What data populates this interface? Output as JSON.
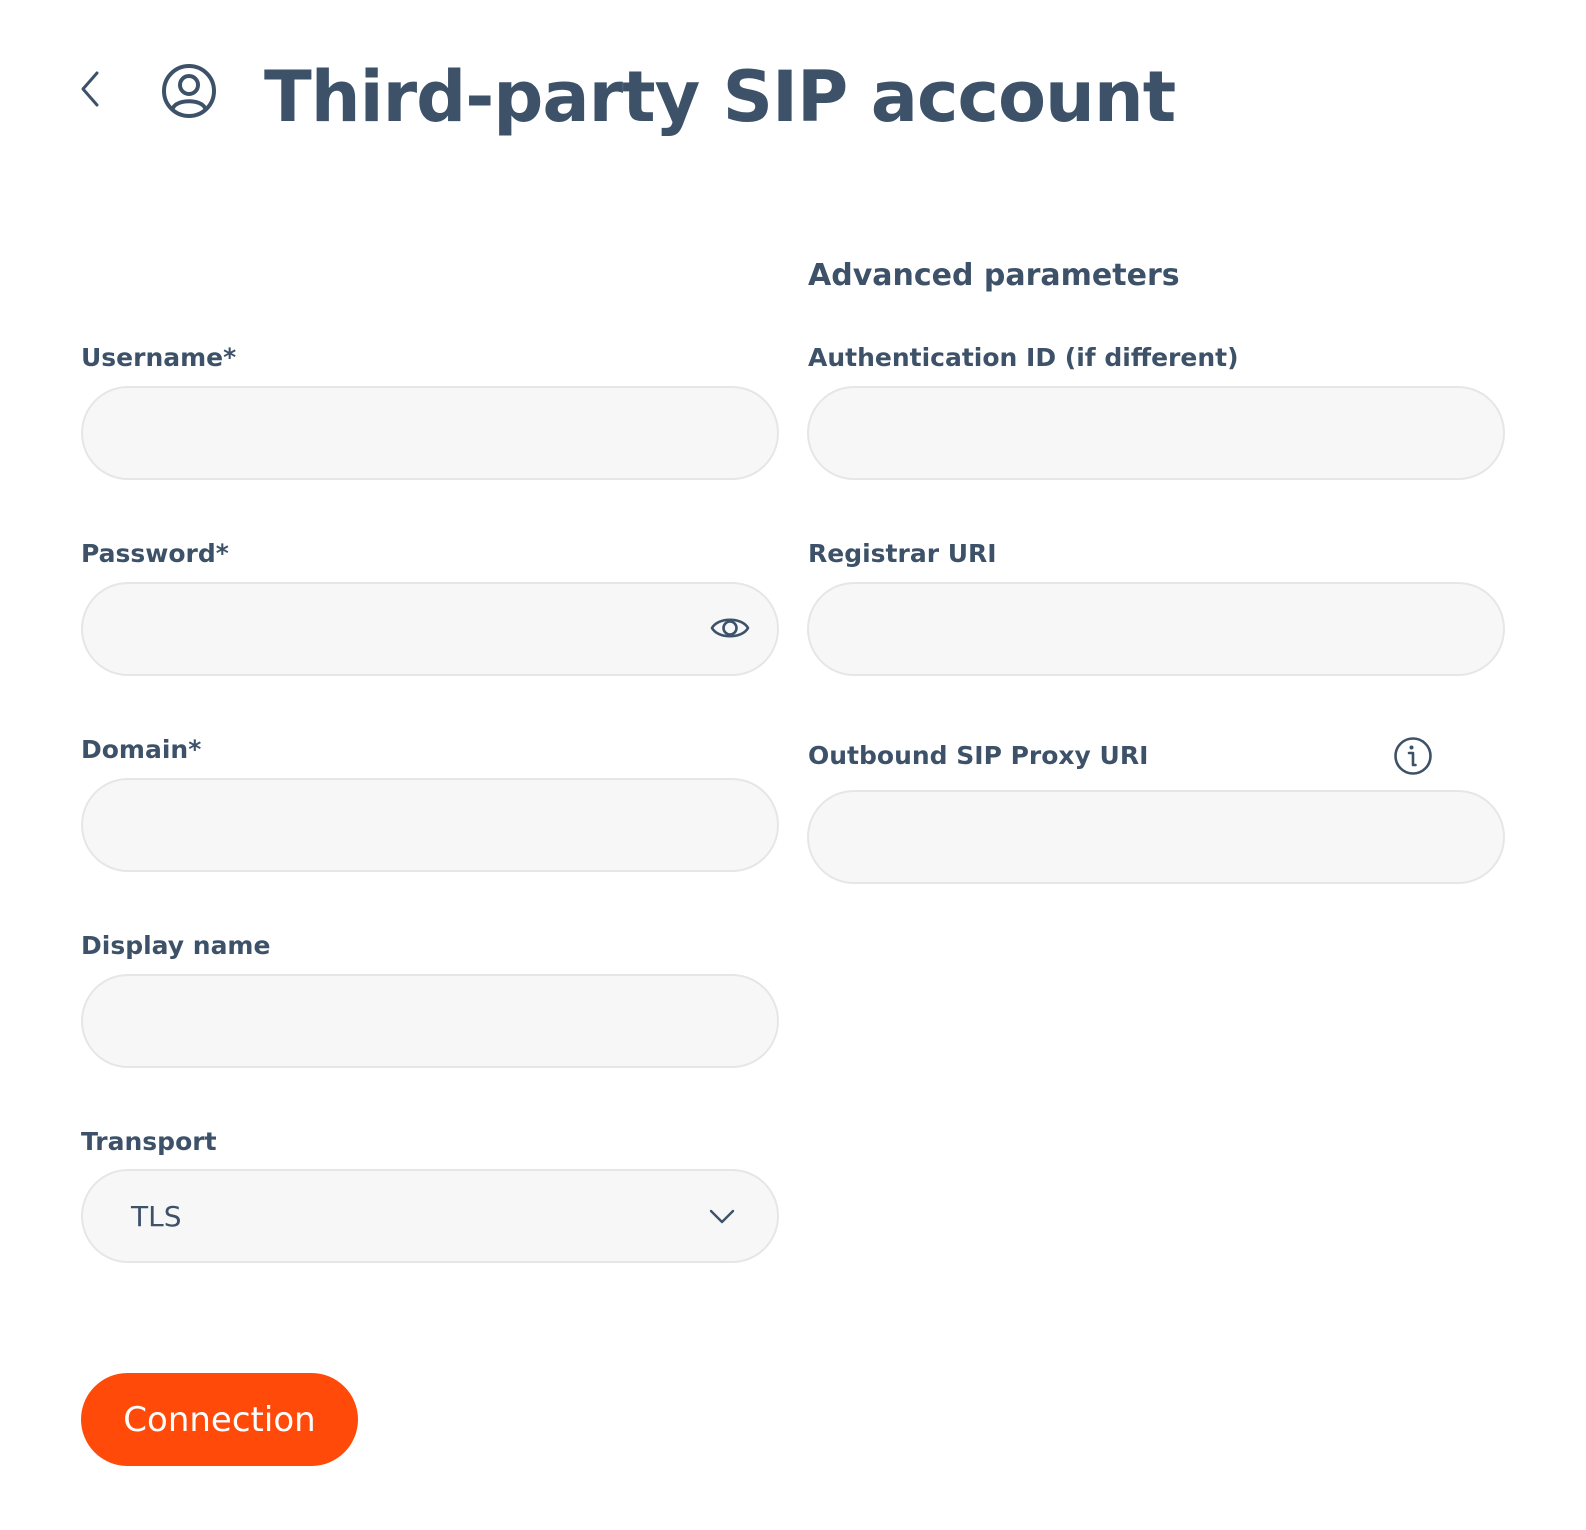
{
  "header": {
    "back_icon": "chevron-left-icon",
    "account_icon": "user-circle-icon",
    "title": "Third-party SIP account"
  },
  "advanced": {
    "heading": "Advanced parameters",
    "auth_id": {
      "label": "Authentication ID (if different)",
      "value": "",
      "placeholder": ""
    },
    "registrar": {
      "label": "Registrar URI",
      "value": "",
      "placeholder": ""
    },
    "outbound_proxy": {
      "label": "Outbound SIP Proxy URI",
      "value": "",
      "placeholder": "",
      "info_icon": "info-circle-icon"
    }
  },
  "form": {
    "username": {
      "label": "Username*",
      "value": "",
      "placeholder": ""
    },
    "password": {
      "label": "Password*",
      "value": "",
      "placeholder": "",
      "toggle_icon": "eye-icon"
    },
    "domain": {
      "label": "Domain*",
      "value": "",
      "placeholder": ""
    },
    "display_name": {
      "label": "Display name",
      "value": "",
      "placeholder": ""
    },
    "transport": {
      "label": "Transport",
      "selected": "TLS",
      "dropdown_icon": "chevron-down-icon"
    }
  },
  "actions": {
    "connect_label": "Connection"
  },
  "colors": {
    "text": "#3d5269",
    "input_bg": "#f7f7f7",
    "input_border": "#e6e6e6",
    "accent": "#ff4a0a"
  }
}
